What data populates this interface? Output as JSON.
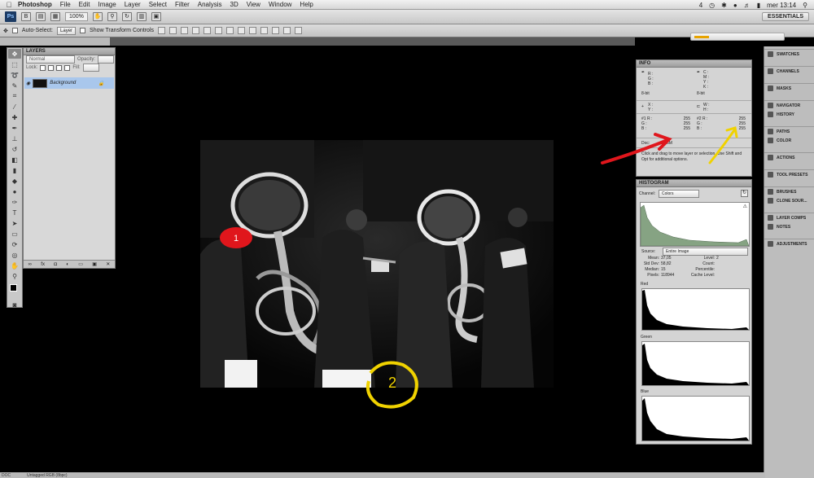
{
  "menubar": {
    "app_name": "Photoshop",
    "items": [
      "File",
      "Edit",
      "Image",
      "Layer",
      "Select",
      "Filter",
      "Analysis",
      "3D",
      "View",
      "Window",
      "Help"
    ],
    "clock": "mer 13:14",
    "badge": "4"
  },
  "appbar": {
    "logo": "Ps",
    "zoom": "100%",
    "workspace": "ESSENTIALS"
  },
  "options": {
    "auto_select_label": "Auto-Select:",
    "auto_select_value": "Layer",
    "transform_label": "Show Transform Controls"
  },
  "progress": {
    "fraction": 0.17
  },
  "layers": {
    "title": "LAYERS",
    "blend_mode": "Normal",
    "opacity_label": "Opacity:",
    "lock_label": "Lock:",
    "fill_label": "Fill:",
    "layer_name": "Background",
    "footer_icons": [
      "link-icon",
      "fx-icon",
      "mask-icon",
      "adjustment-icon",
      "folder-icon",
      "new-layer-icon",
      "trash-icon"
    ]
  },
  "info": {
    "title": "INFO",
    "rgb_labels": [
      "R :",
      "G :",
      "B :"
    ],
    "cmyk_labels": [
      "C :",
      "M :",
      "Y :",
      "K :"
    ],
    "bit_depth_1": "8-bit",
    "bit_depth_2": "8-bit",
    "xy_labels": [
      "X :",
      "Y :"
    ],
    "wh_labels": [
      "W :",
      "H :"
    ],
    "sample1_labels": [
      "#1 R :",
      "G :",
      "B :"
    ],
    "sample1_values": [
      "255",
      "255",
      "255"
    ],
    "sample2_labels": [
      "#2 R :",
      "G :",
      "B :"
    ],
    "sample2_values": [
      "255",
      "255",
      "255"
    ],
    "doc_label": "Doc:",
    "doc_size": "1,36M",
    "hint": "Click and drag to move layer or selection. Use Shift and Opt for additional options."
  },
  "histogram": {
    "title": "HISTOGRAM",
    "channel_label": "Channel:",
    "channel_value": "Colors",
    "source_label": "Source:",
    "source_value": "Entire Image",
    "stats_left": [
      {
        "label": "Mean:",
        "value": "37,05"
      },
      {
        "label": "Std Dev:",
        "value": "58,82"
      },
      {
        "label": "Median:",
        "value": "15"
      },
      {
        "label": "Pixels:",
        "value": "118944"
      }
    ],
    "stats_right": [
      {
        "label": "Level:",
        "value": ""
      },
      {
        "label": "Count:",
        "value": ""
      },
      {
        "label": "Percentile:",
        "value": ""
      },
      {
        "label": "Cache Level:",
        "value": "2"
      }
    ],
    "channels": [
      "Red",
      "Green",
      "Blue"
    ]
  },
  "dock": {
    "groups": [
      [
        "SWATCHES"
      ],
      [
        "CHANNELS"
      ],
      [
        "MASKS"
      ],
      [
        "NAVIGATOR",
        "HISTORY"
      ],
      [
        "PATHS",
        "COLOR"
      ],
      [
        "ACTIONS"
      ],
      [
        "TOOL PRESETS"
      ],
      [
        "BRUSHES",
        "CLONE SOUR..."
      ],
      [
        "LAYER COMPS",
        "NOTES"
      ],
      [
        "ADJUSTMENTS"
      ]
    ]
  },
  "status": {
    "zoom": "DOC",
    "profile": "Untagged RGB (8bpc)"
  },
  "annotations": {
    "marker_1": "1",
    "marker_2": "2",
    "arrow_red_color": "#e0161c",
    "arrow_yellow_color": "#f0d200"
  }
}
